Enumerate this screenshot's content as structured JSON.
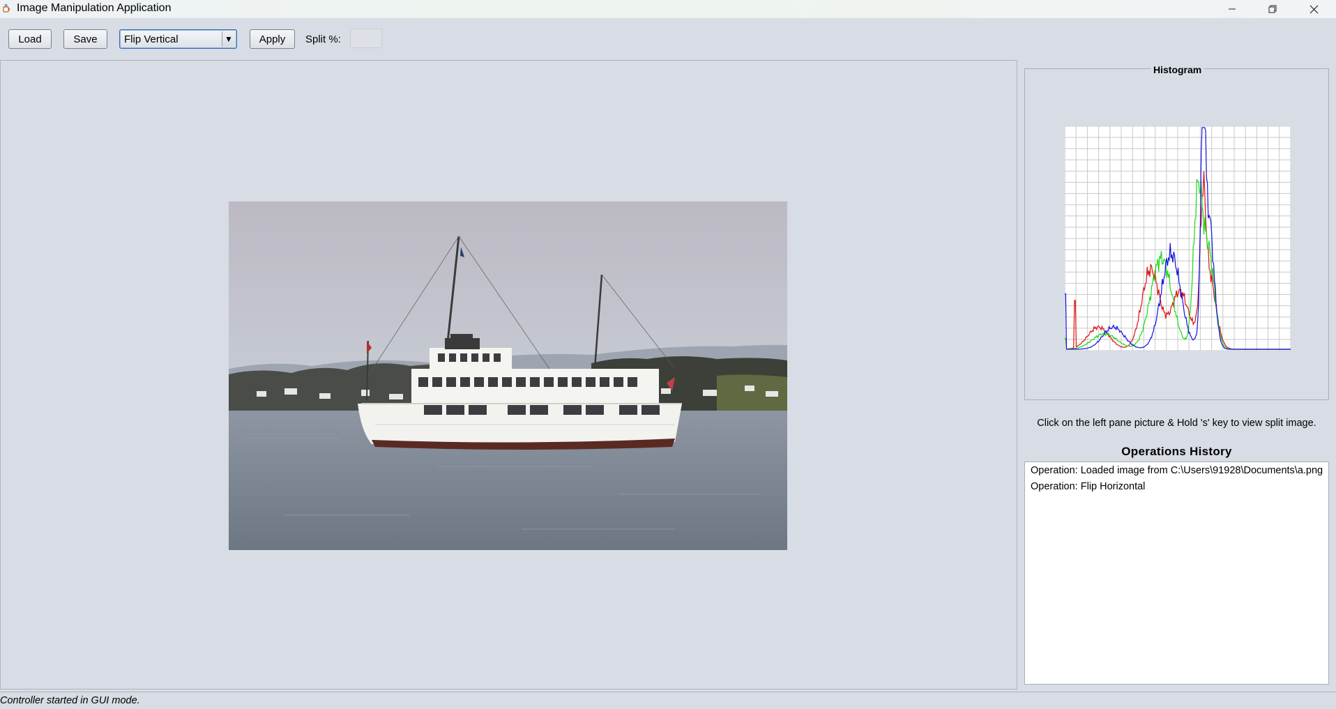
{
  "window": {
    "title": "Image Manipulation Application",
    "icon": "java-cup-icon",
    "controls": [
      "minimize-icon",
      "restore-icon",
      "close-icon"
    ]
  },
  "toolbar": {
    "load_label": "Load",
    "save_label": "Save",
    "operation_selected": "Flip Vertical",
    "apply_label": "Apply",
    "split_label": "Split %:",
    "split_value": ""
  },
  "image_pane": {
    "image_description_icon": "loaded-photo",
    "colors": {
      "sky": "#c4c9d2",
      "water": "#7b8592",
      "boat": "#f3f3f1",
      "hills": "#3d4038"
    }
  },
  "histogram": {
    "title": "Histogram",
    "colors": {
      "red": "#e01010",
      "green": "#18d818",
      "blue": "#1010e0",
      "grid": "#c8c8c8"
    }
  },
  "hint_text": "Click on the left pane picture & Hold 's' key to view split image.",
  "history": {
    "title": "Operations History",
    "items": [
      "Operation: Loaded image from C:\\Users\\91928\\Documents\\a.png",
      "Operation: Flip Horizontal"
    ]
  },
  "status": {
    "text": "Controller started in GUI mode."
  }
}
